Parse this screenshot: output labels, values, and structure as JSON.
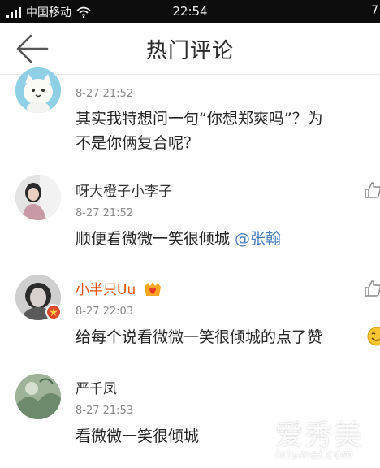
{
  "status_bar": {
    "carrier": "中国移动",
    "time": "22:54",
    "right_partial": "7"
  },
  "header": {
    "title": "热门评论",
    "back_icon": "arrow-left-icon"
  },
  "comments": [
    {
      "username": "",
      "timestamp": "8-27 21:52",
      "text_line1": "其实我特想问一句“你想郑爽吗”？为",
      "text_line2": "不是你俩复合呢？"
    },
    {
      "username": "呀大橙子小李子",
      "timestamp": "8-27 21:52",
      "text": "顺便看微微一笑很倾城 ",
      "mention": "@张翰"
    },
    {
      "username": "小半只Uu",
      "username_color": "#e8520c",
      "timestamp": "8-27 22:03",
      "text": "给每个说看微微一笑很倾城的点了赞"
    },
    {
      "username": "严千凤",
      "timestamp": "8-27 21:53",
      "text": "看微微一笑很倾城"
    }
  ],
  "icons": {
    "like": "thumbs-up-icon",
    "vip": "crown-heart-icon",
    "verified": "star-badge-icon",
    "emoji": "smiling-emoji-icon"
  },
  "watermark": {
    "logo": "爱秀美",
    "url": "ixiumei.com"
  }
}
